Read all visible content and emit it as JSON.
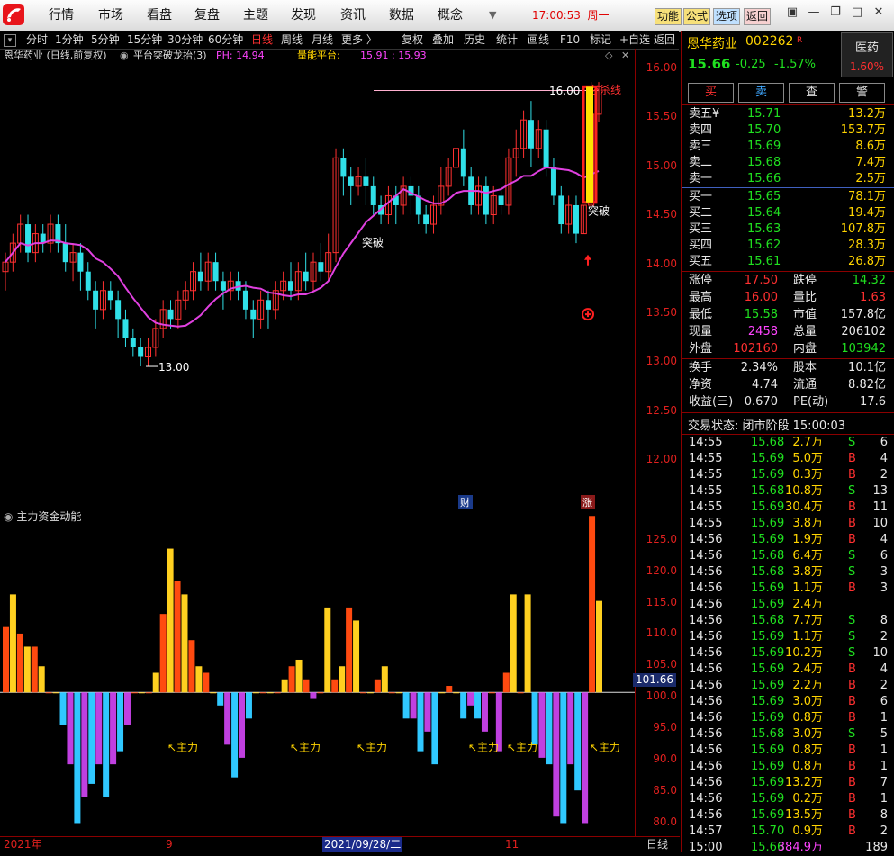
{
  "menu": {
    "items": [
      "行情",
      "市场",
      "看盘",
      "复盘",
      "主题",
      "发现",
      "资讯",
      "数据",
      "概念"
    ],
    "clock": "17:00:53",
    "weekday": "周一",
    "buttons": {
      "func": "功能",
      "formula": "公式",
      "pick": "选项",
      "back": "返回"
    }
  },
  "toolbar": {
    "periods": [
      "分时",
      "1分钟",
      "5分钟",
      "15分钟",
      "30分钟",
      "60分钟",
      "日线",
      "周线",
      "月线",
      "更多 〉"
    ],
    "active_period": "日线",
    "tools": [
      "复权",
      "叠加",
      "历史",
      "统计",
      "画线",
      "F10",
      "标记",
      "+自选",
      "返回"
    ]
  },
  "info": {
    "stock_label": "恩华药业 (日线,前复权)",
    "indicator": "平台突破龙抬(3)",
    "ph": "PH: 14.94",
    "platform_label": "量能平台:",
    "platform_values": "15.91 : 15.93"
  },
  "main_chart": {
    "annotations": {
      "high": "16.00",
      "low": "13.00",
      "breakout1": "突破",
      "breakout2": "突破",
      "kill_line": "必杀线",
      "finance_badge": "财",
      "limit_badge": "涨"
    },
    "y_ticks": [
      "16.00",
      "15.50",
      "15.00",
      "14.50",
      "14.00",
      "13.50",
      "13.00",
      "12.50",
      "12.00"
    ]
  },
  "chart_data": [
    {
      "type": "candlestick",
      "title": "恩华药业 (日线,前复权)",
      "ylim": [
        11.5,
        16.2
      ],
      "ma_color": "#e040e0",
      "candles": [
        [
          14.0,
          14.1,
          13.8,
          14.2
        ],
        [
          14.1,
          14.3,
          14.0,
          14.4
        ],
        [
          14.3,
          14.5,
          14.2,
          14.6
        ],
        [
          14.5,
          14.2,
          14.1,
          14.6
        ],
        [
          14.2,
          14.4,
          14.1,
          14.5
        ],
        [
          14.4,
          14.3,
          14.2,
          14.5
        ],
        [
          14.3,
          14.5,
          14.2,
          14.6
        ],
        [
          14.5,
          14.3,
          14.2,
          14.6
        ],
        [
          14.3,
          14.1,
          14.0,
          14.5
        ],
        [
          14.1,
          14.2,
          13.9,
          14.3
        ],
        [
          14.2,
          14.0,
          13.8,
          14.3
        ],
        [
          14.0,
          13.8,
          13.7,
          14.1
        ],
        [
          13.8,
          13.6,
          13.4,
          13.9
        ],
        [
          13.6,
          13.8,
          13.5,
          13.9
        ],
        [
          13.8,
          13.7,
          13.6,
          13.9
        ],
        [
          13.7,
          13.5,
          13.3,
          13.8
        ],
        [
          13.5,
          13.3,
          13.2,
          13.6
        ],
        [
          13.3,
          13.2,
          13.1,
          13.4
        ],
        [
          13.2,
          13.1,
          13.0,
          13.3
        ],
        [
          13.1,
          13.2,
          13.0,
          13.3
        ],
        [
          13.2,
          13.4,
          13.1,
          13.5
        ],
        [
          13.4,
          13.6,
          13.3,
          13.7
        ],
        [
          13.6,
          13.5,
          13.4,
          13.7
        ],
        [
          13.5,
          13.7,
          13.4,
          13.8
        ],
        [
          13.7,
          13.8,
          13.6,
          13.9
        ],
        [
          13.8,
          14.0,
          13.7,
          14.1
        ],
        [
          14.0,
          13.9,
          13.8,
          14.2
        ],
        [
          13.9,
          14.1,
          13.8,
          14.2
        ],
        [
          14.1,
          13.9,
          13.8,
          14.2
        ],
        [
          13.9,
          13.8,
          13.6,
          14.0
        ],
        [
          13.8,
          13.9,
          13.7,
          14.0
        ],
        [
          13.9,
          13.8,
          13.7,
          14.0
        ],
        [
          13.8,
          13.6,
          13.5,
          13.9
        ],
        [
          13.6,
          13.5,
          13.3,
          13.7
        ],
        [
          13.5,
          13.7,
          13.4,
          13.8
        ],
        [
          13.7,
          13.6,
          13.4,
          13.8
        ],
        [
          13.6,
          13.8,
          13.5,
          13.9
        ],
        [
          13.8,
          13.9,
          13.7,
          14.0
        ],
        [
          13.9,
          13.8,
          13.7,
          14.1
        ],
        [
          13.8,
          14.0,
          13.7,
          14.1
        ],
        [
          14.0,
          13.9,
          13.8,
          14.2
        ],
        [
          13.9,
          14.1,
          13.8,
          14.2
        ],
        [
          14.1,
          14.0,
          13.9,
          14.3
        ],
        [
          14.0,
          14.2,
          13.9,
          14.4
        ],
        [
          14.2,
          15.2,
          14.1,
          15.3
        ],
        [
          15.2,
          15.0,
          14.8,
          15.3
        ],
        [
          15.0,
          14.9,
          14.7,
          15.1
        ],
        [
          14.9,
          15.0,
          14.8,
          15.1
        ],
        [
          15.0,
          14.9,
          14.7,
          15.2
        ],
        [
          14.9,
          14.7,
          14.6,
          15.0
        ],
        [
          14.7,
          14.6,
          14.5,
          14.8
        ],
        [
          14.6,
          14.8,
          14.5,
          14.9
        ],
        [
          14.8,
          14.7,
          14.5,
          14.9
        ],
        [
          14.7,
          14.9,
          14.6,
          15.0
        ],
        [
          14.9,
          14.8,
          14.6,
          15.0
        ],
        [
          14.8,
          14.6,
          14.5,
          14.9
        ],
        [
          14.6,
          14.5,
          14.4,
          14.7
        ],
        [
          14.5,
          14.7,
          14.4,
          14.8
        ],
        [
          14.7,
          14.9,
          14.6,
          15.1
        ],
        [
          14.9,
          15.1,
          14.8,
          15.2
        ],
        [
          15.1,
          15.3,
          15.0,
          15.4
        ],
        [
          15.3,
          15.0,
          14.9,
          15.5
        ],
        [
          15.0,
          14.7,
          14.6,
          15.1
        ],
        [
          14.7,
          14.9,
          14.6,
          15.0
        ],
        [
          14.9,
          14.6,
          14.5,
          15.0
        ],
        [
          14.6,
          14.8,
          14.5,
          14.9
        ],
        [
          14.8,
          14.7,
          14.6,
          14.9
        ],
        [
          14.7,
          15.2,
          14.6,
          15.3
        ],
        [
          15.2,
          15.3,
          15.0,
          15.5
        ],
        [
          15.3,
          15.6,
          15.2,
          15.7
        ],
        [
          15.6,
          15.3,
          15.1,
          15.8
        ],
        [
          15.3,
          15.5,
          15.2,
          15.6
        ],
        [
          15.5,
          15.1,
          15.0,
          15.6
        ],
        [
          15.1,
          14.8,
          14.7,
          15.2
        ],
        [
          14.8,
          14.5,
          14.4,
          14.9
        ],
        [
          14.5,
          14.7,
          14.4,
          14.8
        ],
        [
          14.7,
          14.4,
          14.3,
          14.8
        ],
        [
          14.4,
          14.7,
          14.4,
          14.7
        ],
        [
          14.7,
          15.66,
          14.7,
          16.0
        ],
        [
          15.66,
          15.95,
          15.58,
          16.0
        ]
      ]
    },
    {
      "type": "bar",
      "title": "主力资金动能",
      "baseline": 100,
      "ylim": [
        78,
        128
      ],
      "labels": [
        "主力",
        "主力",
        "主力",
        "主力",
        "主力",
        "主力"
      ],
      "current_value": "101.66",
      "values": [
        110,
        115,
        109,
        107,
        107,
        104,
        100,
        100,
        95,
        89,
        80,
        84,
        86,
        89,
        84,
        89,
        91,
        95,
        100,
        100,
        100,
        103,
        112,
        122,
        117,
        115,
        108,
        104,
        103,
        100,
        98,
        92,
        87,
        90,
        96,
        100,
        100,
        100,
        100,
        102,
        104,
        105,
        102,
        99,
        100,
        113,
        102,
        104,
        113,
        111,
        100,
        100,
        102,
        104,
        100,
        100,
        96,
        96,
        91,
        94,
        89,
        100,
        101,
        100,
        96,
        98,
        96,
        94,
        100,
        91,
        103,
        115,
        100,
        115,
        92,
        90,
        89,
        81,
        80,
        89,
        85,
        80,
        127,
        114
      ]
    }
  ],
  "sub_chart": {
    "y_ticks": [
      "125.0",
      "120.0",
      "115.0",
      "110.0",
      "105.0",
      "100.0",
      "95.0",
      "90.0",
      "85.0",
      "80.0"
    ],
    "indicator_value": "101.66"
  },
  "bottom_axis": {
    "year": "2021年",
    "month9": "9",
    "cursor_date": "2021/09/28/二",
    "month11": "11",
    "period": "日线"
  },
  "right_panel": {
    "name": "恩华药业",
    "code": "002262",
    "tag": "R",
    "sector": "医药",
    "price": "15.66",
    "change": "-0.25",
    "change_pct": "-1.57%",
    "sector_pct": "1.60%",
    "actions": [
      "买",
      "卖",
      "查",
      "警"
    ],
    "ask": [
      [
        "卖五¥",
        "15.71",
        "13.2万"
      ],
      [
        "卖四",
        "15.70",
        "153.7万"
      ],
      [
        "卖三",
        "15.69",
        "8.6万"
      ],
      [
        "卖二",
        "15.68",
        "7.4万"
      ],
      [
        "卖一",
        "15.66",
        "2.5万"
      ]
    ],
    "bid": [
      [
        "买一",
        "15.65",
        "78.1万"
      ],
      [
        "买二",
        "15.64",
        "19.4万"
      ],
      [
        "买三",
        "15.63",
        "107.8万"
      ],
      [
        "买四",
        "15.62",
        "28.3万"
      ],
      [
        "买五",
        "15.61",
        "26.8万"
      ]
    ],
    "stats": [
      [
        "涨停",
        "17.50",
        "跌停",
        "14.32"
      ],
      [
        "最高",
        "16.00",
        "量比",
        "1.63"
      ],
      [
        "最低",
        "15.58",
        "市值",
        "157.8亿"
      ],
      [
        "现量",
        "2458",
        "总量",
        "206102"
      ],
      [
        "外盘",
        "102160",
        "内盘",
        "103942"
      ]
    ],
    "fundamentals": [
      [
        "换手",
        "2.34%",
        "股本",
        "10.1亿"
      ],
      [
        "净资",
        "4.74",
        "流通",
        "8.82亿"
      ],
      [
        "收益(三)",
        "0.670",
        "PE(动)",
        "17.6"
      ]
    ],
    "status": "交易状态: 闭市阶段 15:00:03",
    "ticks": [
      [
        "14:55",
        "15.68",
        "2.7万",
        "S",
        "6"
      ],
      [
        "14:55",
        "15.69",
        "5.0万",
        "B",
        "4"
      ],
      [
        "14:55",
        "15.69",
        "0.3万",
        "B",
        "2"
      ],
      [
        "14:55",
        "15.68",
        "10.8万",
        "S",
        "13"
      ],
      [
        "14:55",
        "15.69",
        "30.4万",
        "B",
        "11"
      ],
      [
        "14:55",
        "15.69",
        "3.8万",
        "B",
        "10"
      ],
      [
        "14:56",
        "15.69",
        "1.9万",
        "B",
        "4"
      ],
      [
        "14:56",
        "15.68",
        "6.4万",
        "S",
        "6"
      ],
      [
        "14:56",
        "15.68",
        "3.8万",
        "S",
        "3"
      ],
      [
        "14:56",
        "15.69",
        "1.1万",
        "B",
        "3"
      ],
      [
        "14:56",
        "15.69",
        "2.4万",
        "",
        ""
      ],
      [
        "14:56",
        "15.68",
        "7.7万",
        "S",
        "8"
      ],
      [
        "14:56",
        "15.69",
        "1.1万",
        "S",
        "2"
      ],
      [
        "14:56",
        "15.69",
        "10.2万",
        "S",
        "10"
      ],
      [
        "14:56",
        "15.69",
        "2.4万",
        "B",
        "4"
      ],
      [
        "14:56",
        "15.69",
        "2.2万",
        "B",
        "2"
      ],
      [
        "14:56",
        "15.69",
        "3.0万",
        "B",
        "6"
      ],
      [
        "14:56",
        "15.69",
        "0.8万",
        "B",
        "1"
      ],
      [
        "14:56",
        "15.68",
        "3.0万",
        "S",
        "5"
      ],
      [
        "14:56",
        "15.69",
        "0.8万",
        "B",
        "1"
      ],
      [
        "14:56",
        "15.69",
        "0.8万",
        "B",
        "1"
      ],
      [
        "14:56",
        "15.69",
        "13.2万",
        "B",
        "7"
      ],
      [
        "14:56",
        "15.69",
        "0.2万",
        "B",
        "1"
      ],
      [
        "14:56",
        "15.69",
        "13.5万",
        "B",
        "8"
      ],
      [
        "14:57",
        "15.70",
        "0.9万",
        "B",
        "2"
      ],
      [
        "15:00",
        "15.66",
        "384.9万",
        "",
        "189"
      ]
    ]
  }
}
